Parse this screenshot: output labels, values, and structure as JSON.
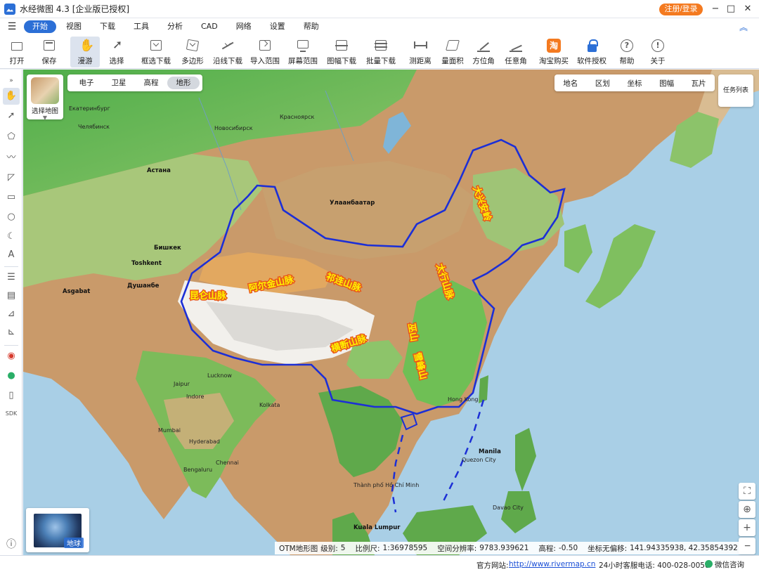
{
  "app": {
    "title": "水经微图 4.3 [企业版已授权]",
    "login_label": "注册/登录"
  },
  "menu": {
    "items": [
      "开始",
      "视图",
      "下载",
      "工具",
      "分析",
      "CAD",
      "网络",
      "设置",
      "帮助"
    ],
    "active": "开始"
  },
  "toolbar": {
    "open": "打开",
    "save": "保存",
    "pan": "漫游",
    "select": "选择",
    "box_download": "框选下载",
    "polygon": "多边形",
    "line_download": "沿线下载",
    "import_range": "导入范围",
    "screen_range": "屏幕范围",
    "sheet_download": "图幅下载",
    "batch_download": "批量下载",
    "measure_distance": "测距离",
    "measure_area": "量面积",
    "azimuth": "方位角",
    "any_angle": "任意角",
    "taobao": "淘宝购买",
    "taobao_glyph": "淘",
    "license": "软件授权",
    "help": "帮助",
    "about": "关于"
  },
  "map": {
    "basemap_label": "选择地图",
    "type_tabs": [
      "电子",
      "卫星",
      "高程",
      "地形"
    ],
    "type_active": "地形",
    "layer_tabs": [
      "地名",
      "区划",
      "坐标",
      "图幅",
      "瓦片"
    ],
    "task_list": "任务列表",
    "globe_label": "地球",
    "mountains": [
      "大兴安岭",
      "太行山脉",
      "巫山",
      "雪峰山",
      "昆仑山脉",
      "阿尔金山脉",
      "祁连山脉",
      "横断山脉"
    ],
    "labels": {
      "ekaterinburg": "Екатеринбург",
      "chelyabinsk": "Челябинск",
      "novosibirsk": "Новосибирск",
      "krasnoyarsk": "Красноярск",
      "astana": "Астана",
      "ulaanbaatar": "Улаанбаатар",
      "bishkek": "Бишкек",
      "toshkent": "Toshkent",
      "dushanbe": "Душанбе",
      "ashgabat": "Asgabat",
      "lucknow": "Lucknow",
      "kolkata": "Kolkata",
      "mumbai": "Mumbai",
      "hyderabad": "Hyderabad",
      "chennai": "Chennai",
      "bengaluru": "Bengaluru",
      "jaipur": "Jaipur",
      "indore": "Indore",
      "hongkong": "Hong Kong",
      "manila": "Manila",
      "quezon": "Quezon City",
      "hcm": "Thành phố Hồ Chí Minh",
      "kl": "Kuala Lumpur",
      "davao": "Davao City"
    },
    "status": {
      "source": "OTM地形图",
      "level_label": "级别:",
      "level": "5",
      "scale_label": "比例尺:",
      "scale": "1:36978595",
      "resolution_label": "空间分辨率:",
      "resolution": "9783.939621",
      "elevation_label": "高程:",
      "elevation": "-0.50",
      "offset_label": "坐标无偏移:",
      "coords": "141.94335938, 42.35854392"
    }
  },
  "footer": {
    "site_label": "官方网站:",
    "site_url": "http://www.rivermap.cn",
    "hotline": "24小时客服电话: 400-028-0050",
    "wechat": "微信咨询"
  },
  "colors": {
    "accent": "#2c6fd6",
    "login": "#f47a20",
    "boundary": "#1c2fd6",
    "mountain_text": "#fff100",
    "mountain_stroke": "#e8581a"
  },
  "icons": {
    "left_tools": [
      "hand-icon",
      "cursor-icon",
      "polygon-icon",
      "polyline-icon",
      "rectangle-icon",
      "circle-icon",
      "sector-icon",
      "text-icon",
      "layers-icon",
      "ruler-icon",
      "mark-icon",
      "angle-icon",
      "flag-icon",
      "link-icon",
      "phone-icon",
      "sdk-icon",
      "help-icon"
    ],
    "left_sdk_label": "SDK"
  }
}
